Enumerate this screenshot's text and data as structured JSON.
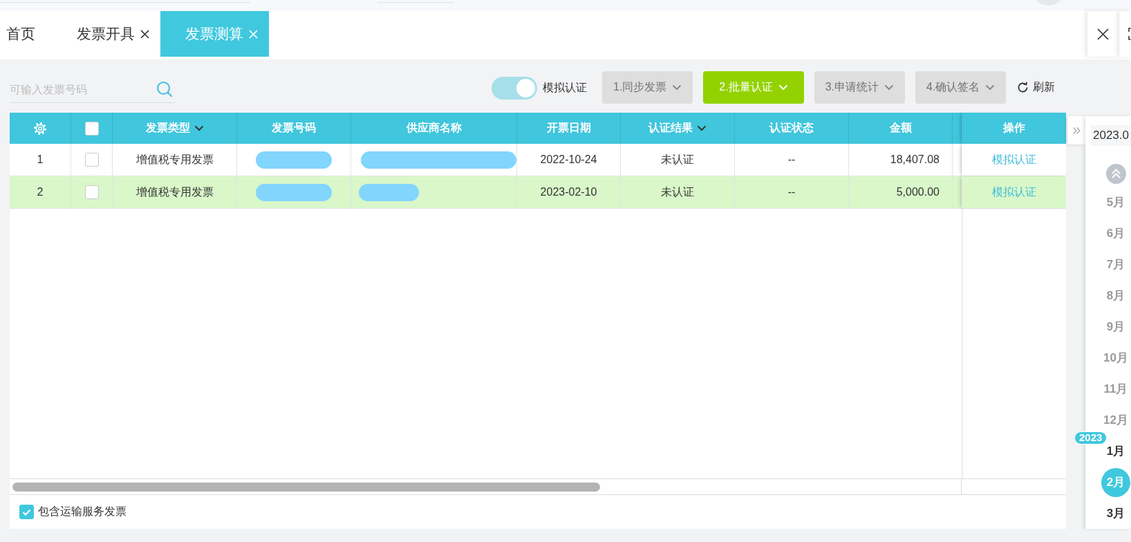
{
  "tabs": [
    {
      "label": "首页",
      "closable": false,
      "selected": false
    },
    {
      "label": "发票开具",
      "closable": true,
      "selected": false
    },
    {
      "label": "发票测算",
      "closable": true,
      "selected": true
    }
  ],
  "toolbar": {
    "search": {
      "placeholder": "可输入发票号码"
    },
    "toggle": {
      "label": "模拟认证",
      "on": true
    },
    "steps": [
      {
        "label": "1.同步发票",
        "disabled": true
      },
      {
        "label": "2.批量认证",
        "disabled": false
      },
      {
        "label": "3.申请统计",
        "disabled": true
      },
      {
        "label": "4.确认签名",
        "disabled": true
      }
    ],
    "refresh": {
      "label": "刷新"
    }
  },
  "table": {
    "columns": [
      {
        "kind": "settings"
      },
      {
        "kind": "select",
        "checked": false
      },
      {
        "kind": "text",
        "label": "发票类型",
        "dropdown": true
      },
      {
        "kind": "text",
        "label": "发票号码",
        "dropdown": false
      },
      {
        "kind": "text",
        "label": "供应商名称",
        "dropdown": false
      },
      {
        "kind": "text",
        "label": "开票日期",
        "dropdown": false
      },
      {
        "kind": "text",
        "label": "认证结果",
        "dropdown": true
      },
      {
        "kind": "text",
        "label": "认证状态",
        "dropdown": false
      },
      {
        "kind": "text",
        "label": "金额",
        "dropdown": false
      },
      {
        "kind": "text",
        "label": "操作",
        "dropdown": false
      }
    ],
    "rows": [
      {
        "index": "1",
        "checked": false,
        "highlighted": false,
        "invoice_type": "增值税专用发票",
        "invoice_number_redacted": true,
        "supplier_redacted": true,
        "date": "2022-10-24",
        "result": "未认证",
        "status": "--",
        "amount": "18,407.08",
        "action": "模拟认证"
      },
      {
        "index": "2",
        "checked": false,
        "highlighted": true,
        "invoice_type": "增值税专用发票",
        "invoice_number_redacted": true,
        "supplier_redacted": true,
        "date": "2023-02-10",
        "result": "未认证",
        "status": "--",
        "amount": "5,000.00",
        "action": "模拟认证"
      }
    ]
  },
  "footer": {
    "include_transport": {
      "label": "包含运输服务发票",
      "checked": true
    }
  },
  "sidebar": {
    "date_field": {
      "value": "2023.0"
    },
    "timeline": [
      {
        "kind": "month",
        "label": "5月",
        "dimmed": true,
        "selected": false
      },
      {
        "kind": "month",
        "label": "6月",
        "dimmed": true,
        "selected": false
      },
      {
        "kind": "month",
        "label": "7月",
        "dimmed": true,
        "selected": false
      },
      {
        "kind": "month",
        "label": "8月",
        "dimmed": true,
        "selected": false
      },
      {
        "kind": "month",
        "label": "9月",
        "dimmed": true,
        "selected": false
      },
      {
        "kind": "month",
        "label": "10月",
        "dimmed": true,
        "selected": false
      },
      {
        "kind": "month",
        "label": "11月",
        "dimmed": true,
        "selected": false
      },
      {
        "kind": "month",
        "label": "12月",
        "dimmed": true,
        "selected": false
      },
      {
        "kind": "year",
        "label": "2023"
      },
      {
        "kind": "month",
        "label": "1月",
        "dimmed": false,
        "selected": false
      },
      {
        "kind": "month",
        "label": "2月",
        "dimmed": false,
        "selected": true
      },
      {
        "kind": "month",
        "label": "3月",
        "dimmed": false,
        "selected": false
      }
    ]
  }
}
